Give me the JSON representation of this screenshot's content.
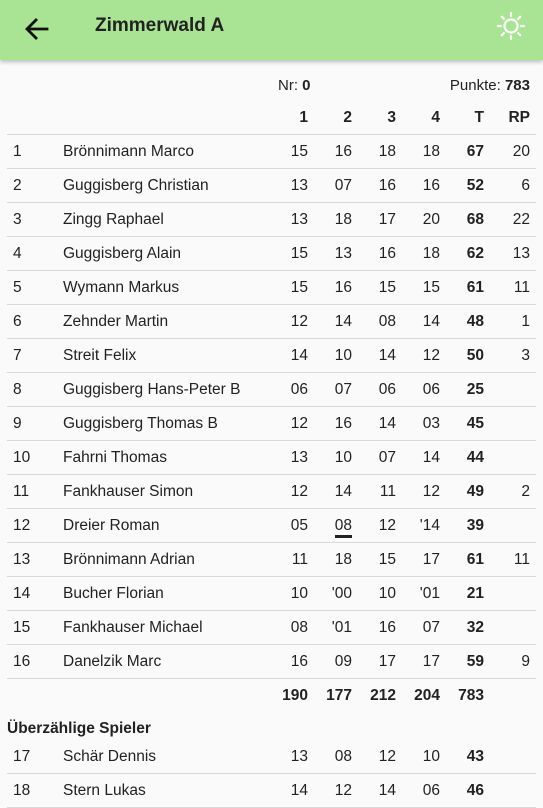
{
  "appbar": {
    "title": "Zimmerwald A",
    "back_icon": "arrow-left-icon",
    "theme_icon": "sun-icon",
    "color": "#a8e494"
  },
  "summary": {
    "nr_label": "Nr:",
    "nr_value": "0",
    "punkte_label": "Punkte:",
    "punkte_value": "783"
  },
  "columns": [
    "1",
    "2",
    "3",
    "4",
    "T",
    "RP"
  ],
  "players": [
    {
      "rank": "1",
      "name": "Brönnimann Marco",
      "s": [
        "15",
        "16",
        "18",
        "18"
      ],
      "t": "67",
      "rp": "20"
    },
    {
      "rank": "2",
      "name": "Guggisberg Christian",
      "s": [
        "13",
        "07",
        "16",
        "16"
      ],
      "t": "52",
      "rp": "6"
    },
    {
      "rank": "3",
      "name": "Zingg Raphael",
      "s": [
        "13",
        "18",
        "17",
        "20"
      ],
      "t": "68",
      "rp": "22"
    },
    {
      "rank": "4",
      "name": "Guggisberg Alain",
      "s": [
        "15",
        "13",
        "16",
        "18"
      ],
      "t": "62",
      "rp": "13"
    },
    {
      "rank": "5",
      "name": "Wymann Markus",
      "s": [
        "15",
        "16",
        "15",
        "15"
      ],
      "t": "61",
      "rp": "11"
    },
    {
      "rank": "6",
      "name": "Zehnder Martin",
      "s": [
        "12",
        "14",
        "08",
        "14"
      ],
      "t": "48",
      "rp": "1"
    },
    {
      "rank": "7",
      "name": "Streit Felix",
      "s": [
        "14",
        "10",
        "14",
        "12"
      ],
      "t": "50",
      "rp": "3"
    },
    {
      "rank": "8",
      "name": "Guggisberg Hans-Peter B",
      "s": [
        "06",
        "07",
        "06",
        "06"
      ],
      "t": "25",
      "rp": ""
    },
    {
      "rank": "9",
      "name": "Guggisberg Thomas B",
      "s": [
        "12",
        "16",
        "14",
        "03"
      ],
      "t": "45",
      "rp": ""
    },
    {
      "rank": "10",
      "name": "Fahrni Thomas",
      "s": [
        "13",
        "10",
        "07",
        "14"
      ],
      "t": "44",
      "rp": ""
    },
    {
      "rank": "11",
      "name": "Fankhauser Simon",
      "s": [
        "12",
        "14",
        "11",
        "12"
      ],
      "t": "49",
      "rp": "2"
    },
    {
      "rank": "12",
      "name": "Dreier Roman",
      "s": [
        "05",
        "08",
        "12",
        "'14"
      ],
      "t": "39",
      "rp": "",
      "highlight": 1
    },
    {
      "rank": "13",
      "name": "Brönnimann Adrian",
      "s": [
        "11",
        "18",
        "15",
        "17"
      ],
      "t": "61",
      "rp": "11"
    },
    {
      "rank": "14",
      "name": "Bucher Florian",
      "s": [
        "10",
        "'00",
        "10",
        "'01"
      ],
      "t": "21",
      "rp": ""
    },
    {
      "rank": "15",
      "name": "Fankhauser Michael",
      "s": [
        "08",
        "'01",
        "16",
        "07"
      ],
      "t": "32",
      "rp": ""
    },
    {
      "rank": "16",
      "name": "Danelzik Marc",
      "s": [
        "16",
        "09",
        "17",
        "17"
      ],
      "t": "59",
      "rp": "9"
    }
  ],
  "totals": {
    "s": [
      "190",
      "177",
      "212",
      "204"
    ],
    "t": "783"
  },
  "extra_section_label": "Überzählige Spieler",
  "extra_players": [
    {
      "rank": "17",
      "name": "Schär Dennis",
      "s": [
        "13",
        "08",
        "12",
        "10"
      ],
      "t": "43",
      "rp": ""
    },
    {
      "rank": "18",
      "name": "Stern Lukas",
      "s": [
        "14",
        "12",
        "14",
        "06"
      ],
      "t": "46",
      "rp": ""
    }
  ]
}
